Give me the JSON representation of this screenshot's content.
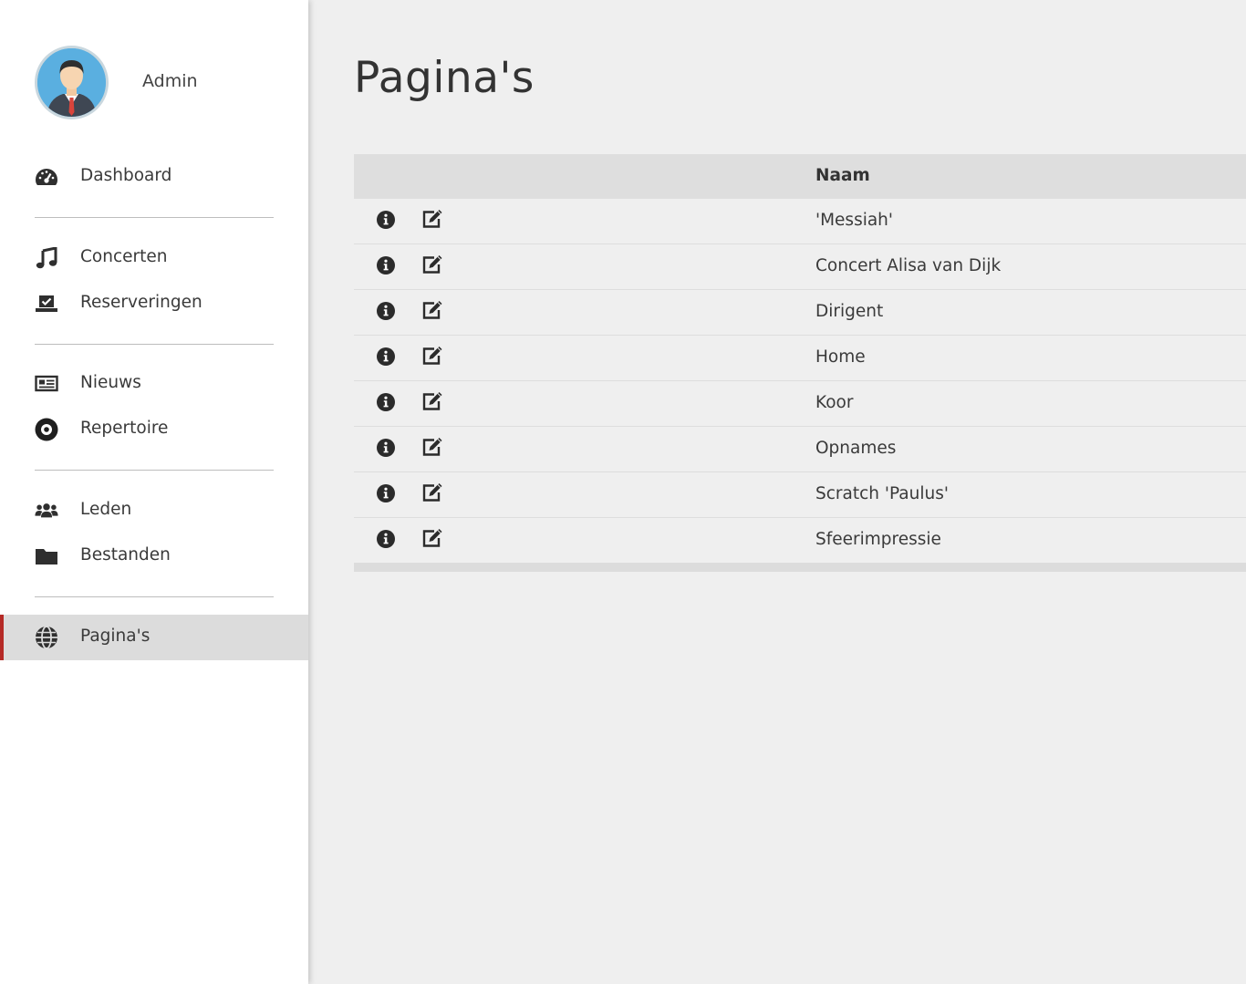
{
  "profile": {
    "name": "Admin",
    "avatar_icon": "user-avatar-icon"
  },
  "nav": {
    "dashboard": {
      "label": "Dashboard",
      "icon": "dashboard-gauge-icon"
    },
    "concerten": {
      "label": "Concerten",
      "icon": "music-note-icon"
    },
    "reserveringen": {
      "label": "Reserveringen",
      "icon": "reservation-check-icon"
    },
    "nieuws": {
      "label": "Nieuws",
      "icon": "newspaper-icon"
    },
    "repertoire": {
      "label": "Repertoire",
      "icon": "record-disc-icon"
    },
    "leden": {
      "label": "Leden",
      "icon": "users-icon"
    },
    "bestanden": {
      "label": "Bestanden",
      "icon": "folder-icon"
    },
    "paginas": {
      "label": "Pagina's",
      "icon": "globe-icon",
      "active": true
    }
  },
  "main": {
    "title": "Pagina's",
    "table": {
      "columns": [
        "",
        "",
        "Naam"
      ],
      "rows": [
        {
          "name": "'Messiah'"
        },
        {
          "name": "Concert Alisa van Dijk"
        },
        {
          "name": "Dirigent"
        },
        {
          "name": "Home"
        },
        {
          "name": "Koor"
        },
        {
          "name": "Opnames"
        },
        {
          "name": "Scratch 'Paulus'"
        },
        {
          "name": "Sfeerimpressie"
        }
      ]
    }
  },
  "colors": {
    "active_accent": "#b52a26",
    "active_bg": "#dcdcdc",
    "sidebar_bg": "#ffffff",
    "content_bg": "#efefef",
    "table_header_bg": "#dedede"
  }
}
